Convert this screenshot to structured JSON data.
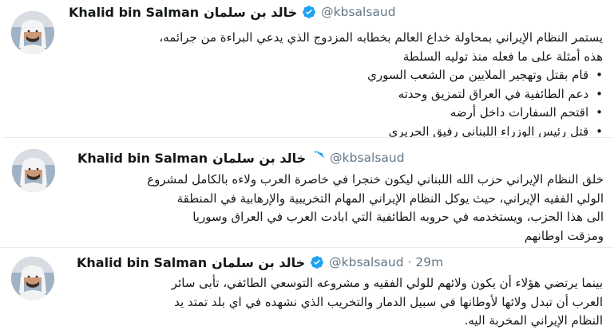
{
  "tweets": [
    {
      "name_en": "Khalid bin Salman",
      "name_ar": "خالد بن سلمان",
      "handle": "@kbsalsaud",
      "lines": [
        "يستمر النظام الإيراني بمحاولة خداع العالم بخطابه المزدوج الذي يدعي البراءة من جرائمه،",
        "هذه أمثلة على ما فعله منذ توليه السلطة"
      ],
      "bullets": [
        "قام بقتل وتهجير الملايين من الشعب السوري",
        "دعم الطائفية في العراق لتمزيق وحدته",
        "اقتحم السفارات داخل أرضه",
        "قتل رئيس الوزراء اللبناني رفيق الحريري"
      ]
    },
    {
      "name_en": "Khalid bin Salman",
      "name_ar": "خالد بن سلمان",
      "handle": "@kbsalsaud",
      "lines": [
        "خلق النظام الإيراني حزب الله اللبناني ليكون خنجرا في خاصرة العرب ولاءه بالكامل لمشروع",
        "الولي الفقيه الإيراني، حيث يوكل النظام الإيراني المهام التخريبية والإرهابية في المنطقة",
        "الى هذا الحزب، ويستخدمه في حروبه الطائفية التي ابادت العرب في العراق وسوريا",
        "ومزقت اوطانهم"
      ]
    },
    {
      "name_en": "Khalid bin Salman",
      "name_ar": "خالد بن سلمان",
      "handle": "@kbsalsaud",
      "separator": "·",
      "time": "29m",
      "lines": [
        "بينما يرتضي هؤلاء أن يكون ولائهم للولي الفقيه و مشروعه التوسعي الطائفي، تأبى سائر",
        "العرب أن تبدل ولائها لأوطانها في سبيل الدمار والتخريب الذي نشهده في اي بلد تمتد يد",
        "النظام الإيراني المخربة اليه."
      ]
    }
  ],
  "colors": {
    "text": "#14171a",
    "secondary": "#657786",
    "verified_blue": "#1da1f2",
    "divider": "#e6ecf0"
  },
  "icons": {
    "avatar": "avatar-photo",
    "verified": "verified-badge-icon"
  }
}
